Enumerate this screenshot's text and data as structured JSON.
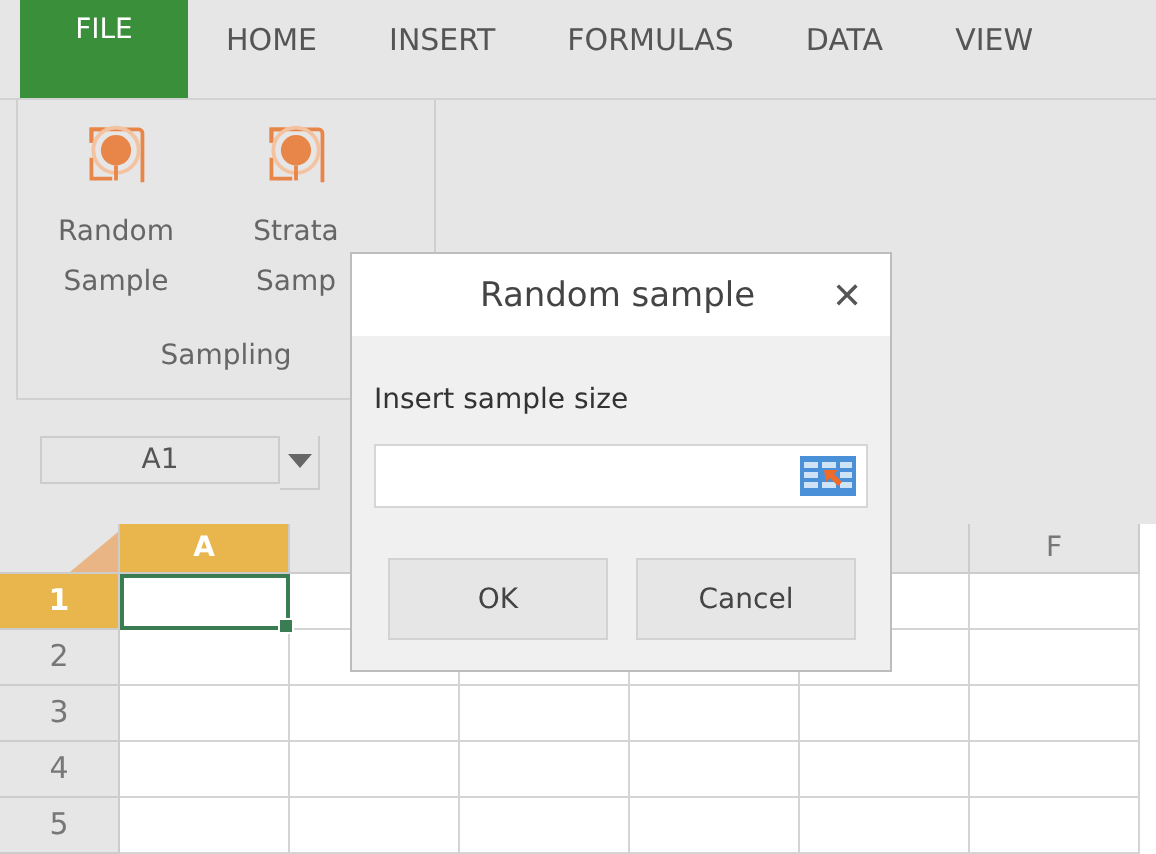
{
  "tabs": [
    {
      "label": "FILE",
      "kind": "file",
      "selected": false
    },
    {
      "label": "HOME",
      "kind": "tab",
      "selected": false
    },
    {
      "label": "INSERT",
      "kind": "tab",
      "selected": false
    },
    {
      "label": "FORMULAS",
      "kind": "tab",
      "selected": false
    },
    {
      "label": "DATA",
      "kind": "tab",
      "selected": false
    },
    {
      "label": "VIEW",
      "kind": "tab",
      "selected": false
    }
  ],
  "ribbon": {
    "group": "Sampling",
    "buttons": [
      {
        "lines": [
          "Random",
          "Sample"
        ]
      },
      {
        "lines": [
          "Strata",
          "Samp"
        ]
      }
    ]
  },
  "name_box": {
    "value": "A1"
  },
  "sheet": {
    "columns": [
      {
        "label": "A",
        "selected": true
      },
      {
        "selected": false
      },
      {},
      {},
      {
        "selected": false
      },
      {
        "label": "F",
        "selected": false
      }
    ],
    "rows": [
      {
        "label": "1",
        "selected": true
      },
      {
        "label": "2",
        "selected": false
      },
      {
        "label": "3",
        "selected": false
      },
      {
        "label": "4",
        "selected": false
      },
      {
        "label": "5",
        "selected": false
      }
    ]
  },
  "dialog": {
    "title": "Random sample",
    "close": "✕",
    "label": "Insert sample size",
    "buttons": [
      "OK",
      "Cancel"
    ]
  }
}
